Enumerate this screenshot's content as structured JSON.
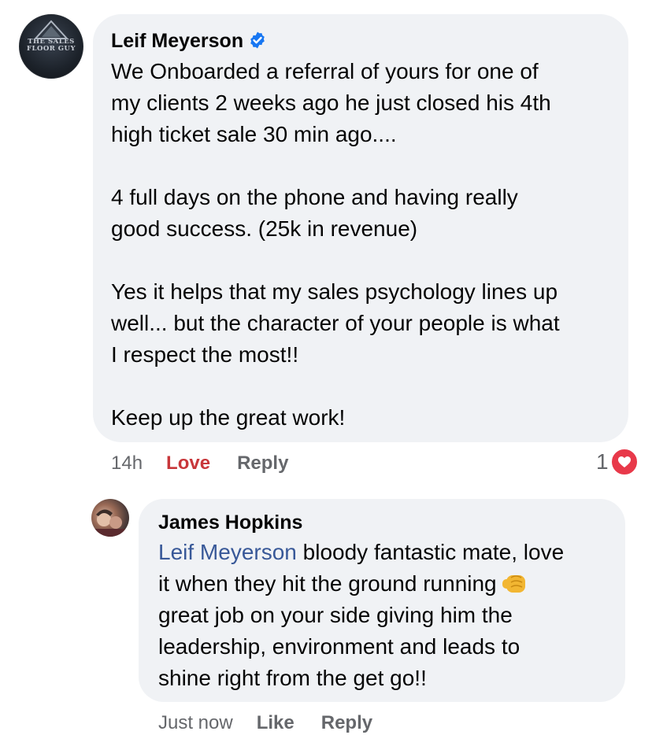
{
  "comment": {
    "author": "Leif Meyerson",
    "avatar_text": [
      "THE SALES",
      "FLOOR GUY"
    ],
    "paragraphs": [
      [
        "We Onboarded a referral of yours for one of",
        "my clients 2 weeks ago he just closed his 4th",
        "high ticket sale 30 min ago...."
      ],
      [
        "4 full days on the phone and having really",
        "good success. (25k in revenue)"
      ],
      [
        "Yes it helps that my sales psychology lines up",
        "well... but the character of your people is what",
        "I respect the most!!"
      ],
      [
        "Keep up the great work!"
      ]
    ],
    "time": "14h",
    "reaction_label": "Love",
    "reply_label": "Reply",
    "reaction_count": "1",
    "reaction_icon": "heart-icon",
    "verified_icon": "verified-badge-icon"
  },
  "reply": {
    "author": "James Hopkins",
    "mention": "Leif Meyerson",
    "line1_rest": " bloody fantastic mate, love",
    "line2": "it when they hit the ground running",
    "line3": "great job on your side giving him the",
    "line4": "leadership, environment and leads to",
    "line5": "shine right from the get go!!",
    "emoji_icon": "fist-bump-icon",
    "time": "Just now",
    "like_label": "Like",
    "reply_label": "Reply"
  },
  "colors": {
    "bubble": "#f0f2f5",
    "secondary_text": "#65676b",
    "love": "#c8373b",
    "mention": "#385898",
    "verified": "#1877f2"
  }
}
